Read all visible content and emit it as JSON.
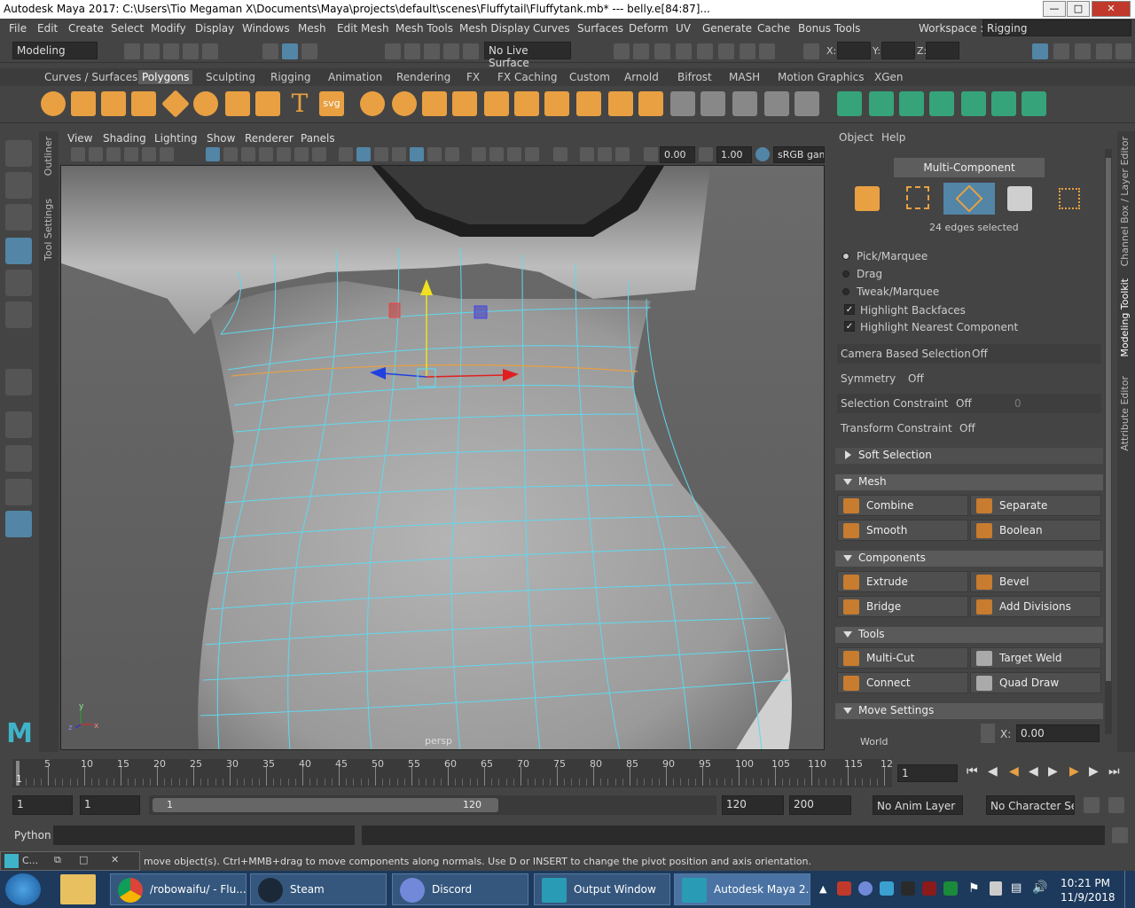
{
  "window": {
    "title": "Autodesk Maya 2017: C:\\Users\\Tio Megaman X\\Documents\\Maya\\projects\\default\\scenes\\Fluffytail\\Fluffytank.mb*   ---   belly.e[84:87]..."
  },
  "menus": [
    "File",
    "Edit",
    "Create",
    "Select",
    "Modify",
    "Display",
    "Windows",
    "Mesh",
    "Edit Mesh",
    "Mesh Tools",
    "Mesh Display",
    "Curves",
    "Surfaces",
    "Deform",
    "UV",
    "Generate",
    "Cache",
    "Bonus Tools"
  ],
  "workspace": {
    "label": "Workspace :",
    "value": "Rigging"
  },
  "statusline": {
    "mode": "Modeling",
    "live_surface": "No Live Surface",
    "x_label": "X:",
    "y_label": "Y:",
    "z_label": "Z:"
  },
  "shelf_tabs": [
    "Curves / Surfaces",
    "Polygons",
    "Sculpting",
    "Rigging",
    "Animation",
    "Rendering",
    "FX",
    "FX Caching",
    "Custom",
    "Arnold",
    "Bifrost",
    "MASH",
    "Motion Graphics",
    "XGen"
  ],
  "shelf_active": "Polygons",
  "shelf_svg_label": "svg",
  "shelf_text_label": "T",
  "side_tabs": {
    "outliner": "Outliner",
    "tool_settings": "Tool Settings"
  },
  "panel_menus": [
    "View",
    "Shading",
    "Lighting",
    "Show",
    "Renderer",
    "Panels"
  ],
  "panel_toolbar": {
    "exposure": "0.00",
    "gamma": "1.00",
    "colorspace": "sRGB gam"
  },
  "viewport": {
    "camera": "persp",
    "axis_y": "y",
    "axis_z": "z",
    "axis_x": "x"
  },
  "modeling_toolkit": {
    "menu": [
      "Object",
      "Help"
    ],
    "mode": "Multi-Component",
    "selection_info": "24 edges selected",
    "pick_modes": [
      "Pick/Marquee",
      "Drag",
      "Tweak/Marquee"
    ],
    "checks": [
      "Highlight Backfaces",
      "Highlight Nearest Component"
    ],
    "camera_based_selection": {
      "label": "Camera Based Selection",
      "value": "Off"
    },
    "symmetry": {
      "label": "Symmetry",
      "value": "Off"
    },
    "selection_constraint": {
      "label": "Selection Constraint",
      "value": "Off",
      "extra": "0"
    },
    "transform_constraint": {
      "label": "Transform Constraint",
      "value": "Off"
    },
    "soft_selection": "Soft Selection",
    "mesh": {
      "title": "Mesh",
      "buttons": [
        "Combine",
        "Separate",
        "Smooth",
        "Boolean"
      ]
    },
    "components": {
      "title": "Components",
      "buttons": [
        "Extrude",
        "Bevel",
        "Bridge",
        "Add Divisions"
      ]
    },
    "tools": {
      "title": "Tools",
      "buttons": [
        "Multi-Cut",
        "Target Weld",
        "Connect",
        "Quad Draw"
      ]
    },
    "move_settings": {
      "title": "Move Settings",
      "space": "World",
      "x_label": "X:",
      "x_value": "0.00"
    }
  },
  "right_tabs": [
    "Channel Box / Layer Editor",
    "Modeling Toolkit",
    "Attribute Editor"
  ],
  "timeline": {
    "ticks": [
      "5",
      "10",
      "15",
      "20",
      "25",
      "30",
      "35",
      "40",
      "45",
      "50",
      "55",
      "60",
      "65",
      "70",
      "75",
      "80",
      "85",
      "90",
      "95",
      "100",
      "105",
      "110",
      "115",
      "12"
    ],
    "current": "1",
    "current_frame": "1"
  },
  "range": {
    "start": "1",
    "anim_start": "1",
    "slider_start": "1",
    "slider_end": "120",
    "anim_end": "120",
    "end": "200",
    "anim_layer": "No Anim Layer",
    "character_set": "No Character Set"
  },
  "command_line": {
    "lang": "Python"
  },
  "help_line": "move object(s). Ctrl+MMB+drag to move components along normals. Use D or INSERT to change the pivot position and axis orientation.",
  "mini_window": {
    "label": "C..."
  },
  "taskbar": {
    "tasks": [
      "/robowaifu/ - Flu...",
      "Steam",
      "Discord",
      "Output Window",
      "Autodesk Maya 2..."
    ],
    "time": "10:21 PM",
    "date": "11/9/2018"
  },
  "colors": {
    "accent": "#5285a6",
    "wire": "#5fd8ef",
    "orange": "#e8a042",
    "taskbar": "#1d3a5c"
  }
}
